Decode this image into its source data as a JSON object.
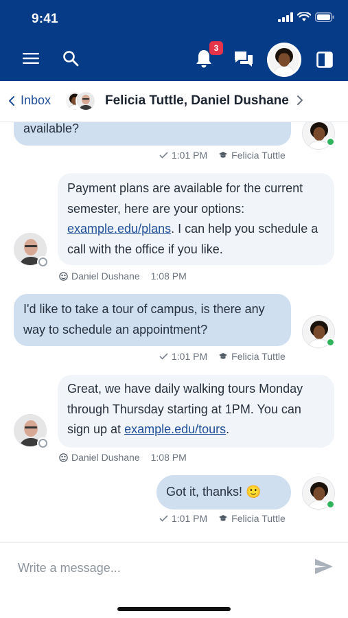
{
  "status_bar": {
    "time": "9:41"
  },
  "header": {
    "notification_count": "3"
  },
  "conversation": {
    "back_label": "Inbox",
    "title": "Felicia Tuttle, Daniel Dushane"
  },
  "messages": [
    {
      "sender": "Felicia Tuttle",
      "time": "1:01 PM",
      "text_lines": [
        "available?"
      ],
      "outgoing": true
    },
    {
      "sender": "Daniel Dushane",
      "time": "1:08 PM",
      "text_before_link": "Payment plans are available for the current semester, here are your options: ",
      "link": "example.edu/plans",
      "text_after_link": ". I can help you schedule a call with the office if you like.",
      "outgoing": false
    },
    {
      "sender": "Felicia Tuttle",
      "time": "1:01 PM",
      "text": "I'd like to take a tour of campus, is there any way to schedule an appointment?",
      "outgoing": true
    },
    {
      "sender": "Daniel Dushane",
      "time": "1:08 PM",
      "text_before_link": "Great, we have daily walking tours Monday through Thursday starting at 1PM. You can sign up at ",
      "link": "example.edu/tours",
      "text_after_link": ".",
      "outgoing": false
    },
    {
      "sender": "Felicia Tuttle",
      "time": "1:01 PM",
      "text": "Got it, thanks! 🙂",
      "outgoing": true
    }
  ],
  "composer": {
    "placeholder": "Write a message..."
  },
  "colors": {
    "brand": "#063b88",
    "outgoing_bubble": "#cfdff0",
    "incoming_bubble": "#f1f4f8",
    "link": "#1f4f99",
    "badge": "#e5344a",
    "online": "#2fb45a"
  },
  "icons": [
    "menu-icon",
    "search-icon",
    "bell-icon",
    "chat-icon",
    "panel-icon",
    "chevron-left-icon",
    "chevron-right-icon",
    "check-icon",
    "graduation-cap-icon",
    "globe-icon",
    "send-icon",
    "signal-icon",
    "wifi-icon",
    "battery-icon"
  ]
}
